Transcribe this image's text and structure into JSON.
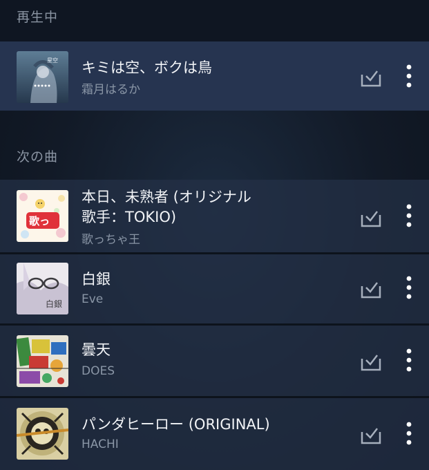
{
  "now_playing": {
    "header": "再生中",
    "track": {
      "title": "キミは空、ボクは鳥",
      "artist": "霜月はるか",
      "art_icon": "album-art-anime-girl",
      "download_icon": "download-check-icon",
      "more_icon": "more-vertical-icon"
    }
  },
  "up_next": {
    "header": "次の曲",
    "tracks": [
      {
        "title": "本日、未熟者 (オリジナル\n歌手：TOKIO)",
        "artist": "歌っちゃ王",
        "art_icon": "album-art-utatcha-ou"
      },
      {
        "title": "白銀",
        "artist": "Eve",
        "art_icon": "album-art-hakugin"
      },
      {
        "title": "曇天",
        "artist": "DOES",
        "art_icon": "album-art-donten"
      },
      {
        "title": "パンダヒーロー (ORIGINAL)",
        "artist": "HACHI",
        "art_icon": "album-art-panda-hero"
      }
    ]
  },
  "colors": {
    "background": "#121a27",
    "row": "#243146",
    "now_row": "#263450",
    "title": "#f2f4f7",
    "subtitle": "#8a96a6",
    "icon": "#a7b0bd"
  }
}
